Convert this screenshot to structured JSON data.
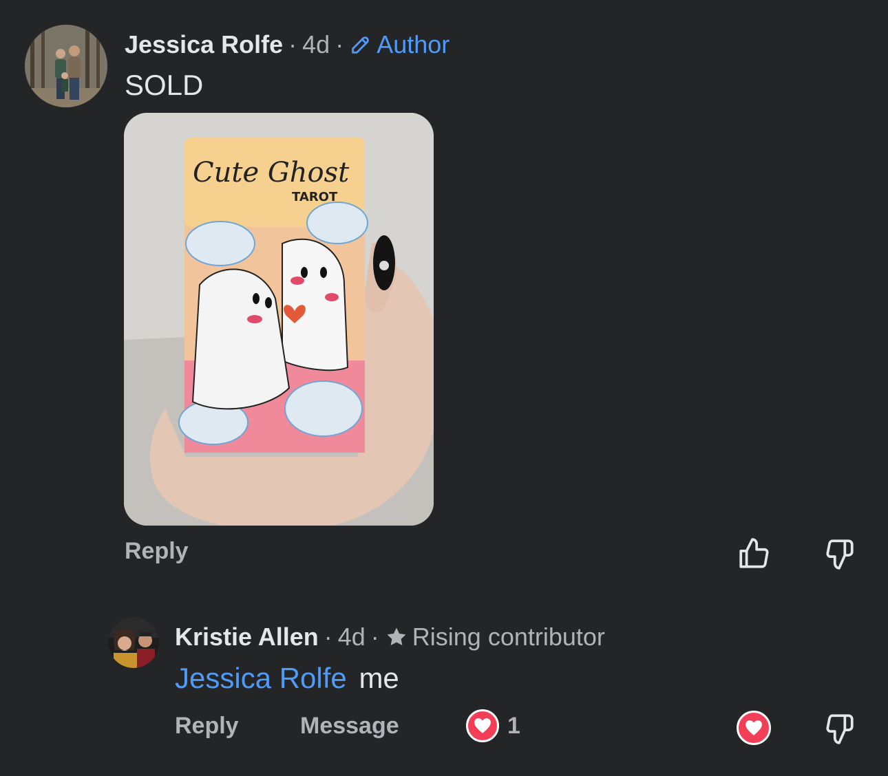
{
  "comment1": {
    "author": "Jessica Rolfe",
    "separator1": "·",
    "time": "4d",
    "separator2": "·",
    "badge": "Author",
    "text": "SOLD",
    "photo_text": {
      "title": "Cute Ghost",
      "subtitle": "TAROT"
    },
    "reply_label": "Reply"
  },
  "comment2": {
    "author": "Kristie Allen",
    "separator1": "·",
    "time": "4d",
    "separator2": "·",
    "badge": "Rising contributor",
    "mention": "Jessica Rolfe",
    "text": "me",
    "reply_label": "Reply",
    "message_label": "Message",
    "reaction_count": "1"
  },
  "colors": {
    "background": "#242526",
    "accent": "#4f9bf7",
    "heart": "#f33e58",
    "muted": "#b0b3b8"
  },
  "icons": {
    "author_badge": "pencil-icon",
    "contributor_badge": "star-icon",
    "like": "thumbs-up-icon",
    "dislike": "thumbs-down-icon",
    "reaction": "heart-icon"
  }
}
